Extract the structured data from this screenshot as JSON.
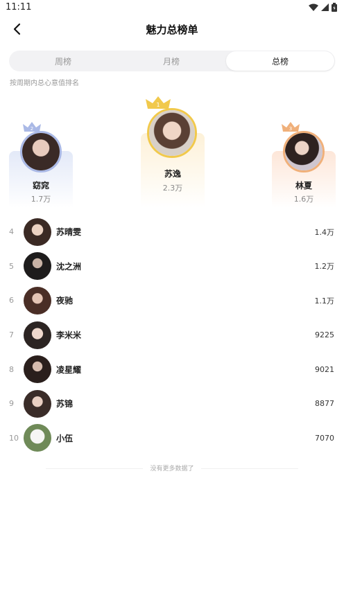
{
  "status_bar": {
    "time": "11:11"
  },
  "header": {
    "title": "魅力总榜单"
  },
  "tabs": [
    {
      "label": "周榜",
      "active": false
    },
    {
      "label": "月榜",
      "active": false
    },
    {
      "label": "总榜",
      "active": true
    }
  ],
  "subtitle": "按周期内总心意值排名",
  "podium": {
    "first": {
      "rank": "1",
      "name": "苏逸",
      "value": "2.3万"
    },
    "second": {
      "rank": "2",
      "name": "窈窕",
      "value": "1.7万"
    },
    "third": {
      "rank": "3",
      "name": "林夏",
      "value": "1.6万"
    }
  },
  "ranking": [
    {
      "rank": "4",
      "name": "苏晴雯",
      "value": "1.4万"
    },
    {
      "rank": "5",
      "name": "沈之洲",
      "value": "1.2万"
    },
    {
      "rank": "6",
      "name": "夜驰",
      "value": "1.1万"
    },
    {
      "rank": "7",
      "name": "李米米",
      "value": "9225"
    },
    {
      "rank": "8",
      "name": "凌星耀",
      "value": "9021"
    },
    {
      "rank": "9",
      "name": "苏锦",
      "value": "8877"
    },
    {
      "rank": "10",
      "name": "小伍",
      "value": "7070"
    }
  ],
  "footer_text": "没有更多数据了",
  "colors": {
    "gold": "#f1c94c",
    "silver": "#aab9e6",
    "bronze": "#f0b07a",
    "tab_bg": "#f2f2f4"
  }
}
